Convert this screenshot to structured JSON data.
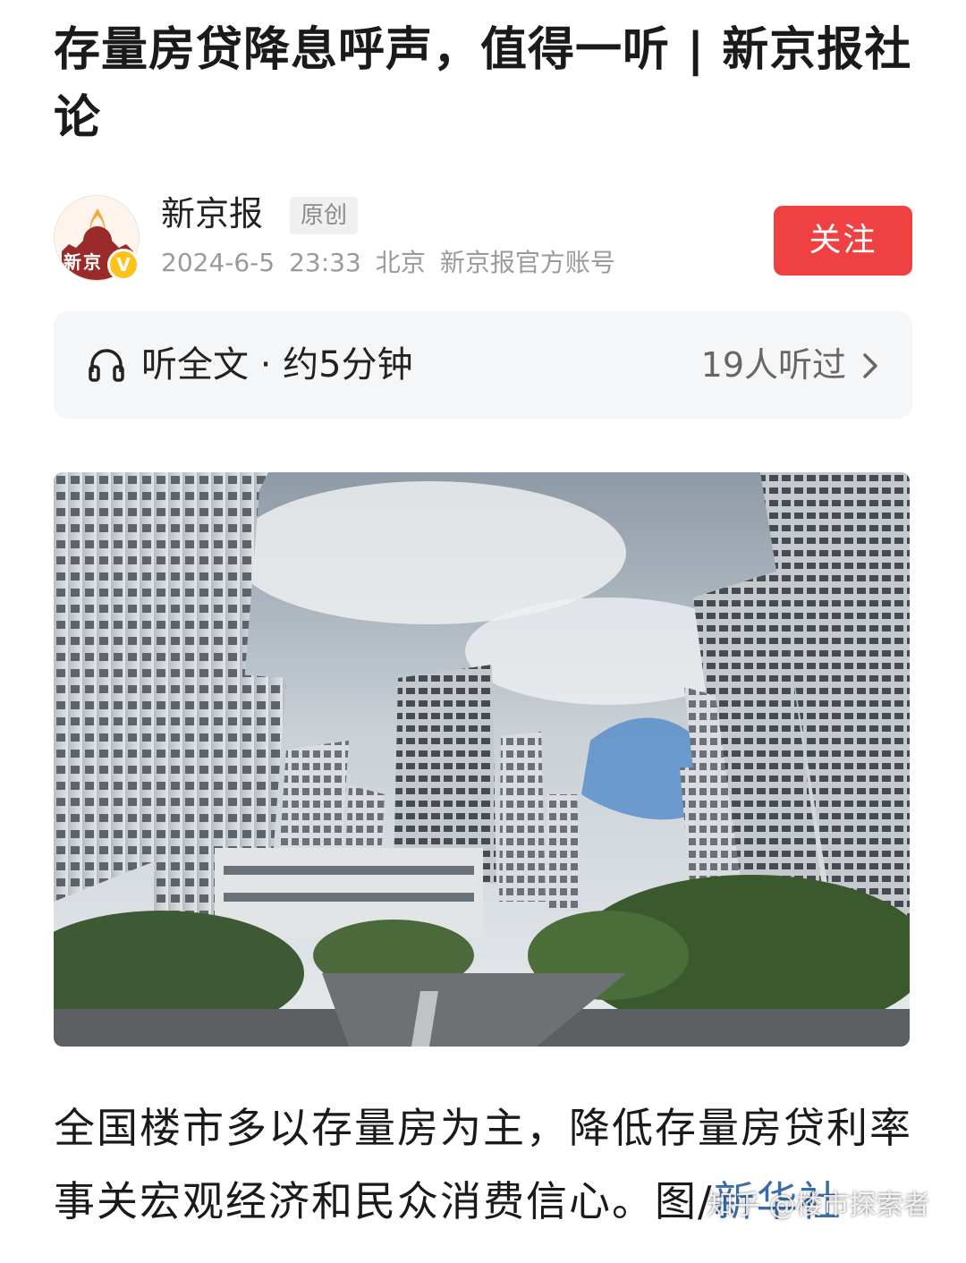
{
  "article": {
    "title": "存量房贷降息呼声，值得一听 | 新京报社论"
  },
  "author": {
    "avatar_text": "新京",
    "name": "新京报",
    "tag": "原创",
    "date": "2024-6-5",
    "time": "23:33",
    "location": "北京",
    "account_type": "新京报官方账号",
    "verified_badge": "V",
    "follow_label": "关注"
  },
  "listen": {
    "label": "听全文 · 约5分钟",
    "count": "19人听过",
    "icon": "headphone-icon"
  },
  "body": {
    "text": "全国楼市多以存量房为主，降低存量房贷利率事关宏观经济和民众消费信心。图/",
    "source_link": "新华社"
  },
  "watermark": "知乎 @楼市探索者",
  "colors": {
    "follow_button": "#f04142",
    "listen_bar_bg": "#f5f6f7",
    "link": "#3a6ea8",
    "verify_badge": "#ffc21a"
  }
}
